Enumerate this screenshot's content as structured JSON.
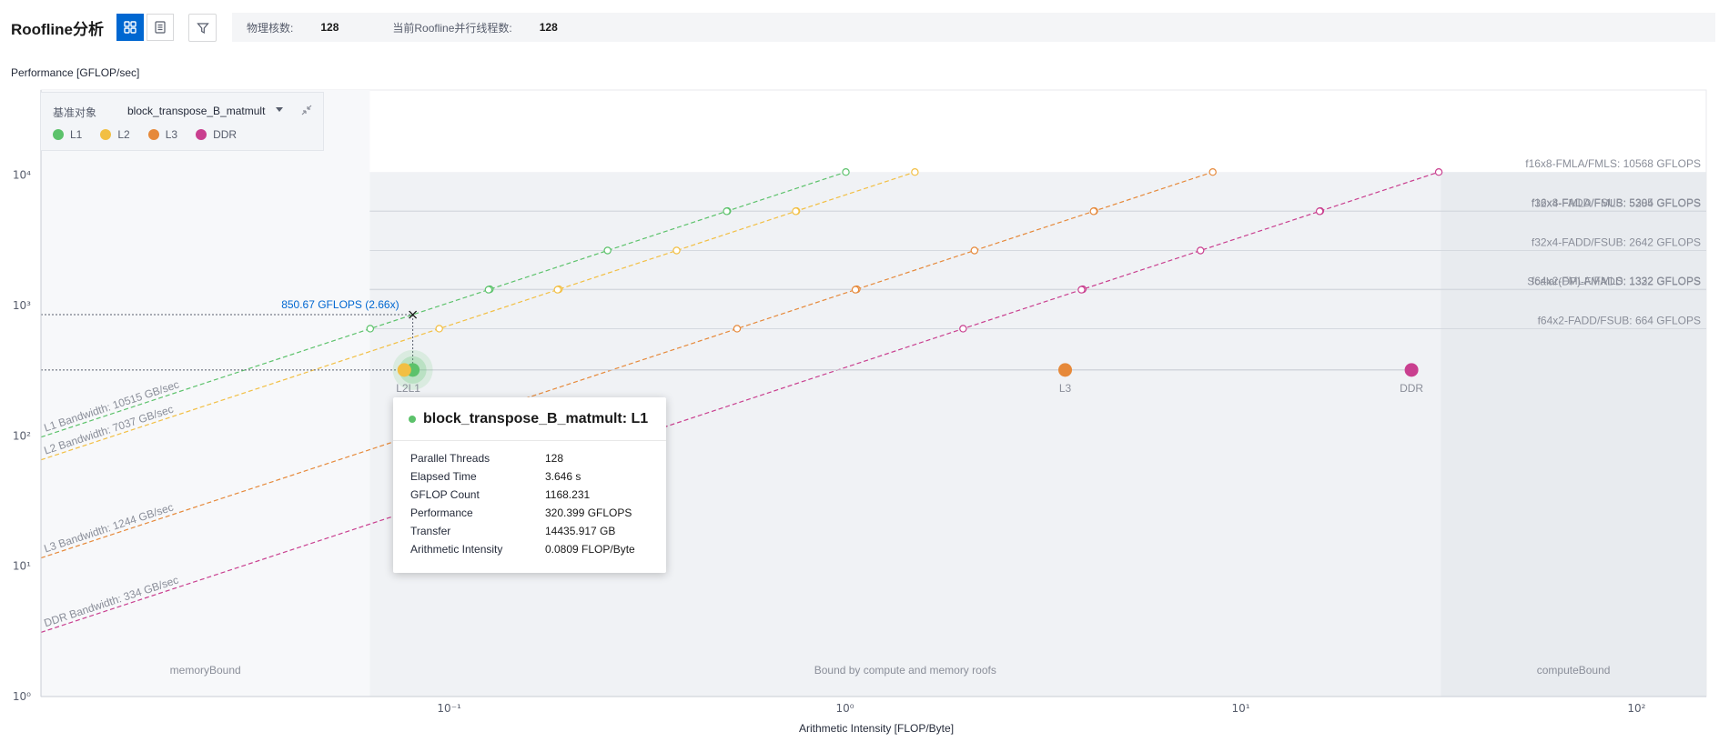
{
  "header": {
    "title": "Roofline分析",
    "physical_cores_label": "物理核数:",
    "physical_cores_value": "128",
    "threads_label": "当前Roofline并行线程数:",
    "threads_value": "128"
  },
  "colors": {
    "accent": "#0067d1",
    "L1": "#5cc26b",
    "L2": "#f2bf43",
    "L3": "#e6893a",
    "DDR": "#c93f8f"
  },
  "legend": {
    "baseline_label": "基准对象",
    "baseline_value": "block_transpose_B_matmult",
    "items": [
      {
        "label": "L1",
        "color": "#5cc26b"
      },
      {
        "label": "L2",
        "color": "#f2bf43"
      },
      {
        "label": "L3",
        "color": "#e6893a"
      },
      {
        "label": "DDR",
        "color": "#c93f8f"
      }
    ]
  },
  "tooltip": {
    "title": "block_transpose_B_matmult: L1",
    "rows": [
      {
        "key": "Parallel Threads",
        "value": "128"
      },
      {
        "key": "Elapsed Time",
        "value": "3.646 s"
      },
      {
        "key": "GFLOP Count",
        "value": "1168.231"
      },
      {
        "key": "Performance",
        "value": "320.399 GFLOPS"
      },
      {
        "key": "Transfer",
        "value": "14435.917 GB"
      },
      {
        "key": "Arithmetic Intensity",
        "value": "0.0809 FLOP/Byte"
      }
    ]
  },
  "chart_data": {
    "type": "scatter",
    "xlabel": "Arithmetic Intensity [FLOP/Byte]",
    "ylabel": "Performance [GFLOP/sec]",
    "xscale": "log",
    "yscale": "log",
    "xlim": [
      0.0093,
      150
    ],
    "ylim": [
      1,
      45000
    ],
    "x_ticks": [
      0.1,
      1,
      10,
      100
    ],
    "x_tick_labels": [
      "10⁻¹",
      "10⁰",
      "10¹",
      "10²"
    ],
    "y_ticks": [
      1,
      10,
      100,
      1000,
      10000
    ],
    "y_tick_labels": [
      "10⁰",
      "10¹",
      "10²",
      "10³",
      "10⁴"
    ],
    "regions": [
      {
        "label": "memoryBound",
        "x_range": [
          0.0093,
          0.063
        ]
      },
      {
        "label": "Bound by compute and memory roofs",
        "x_range": [
          0.063,
          32
        ]
      },
      {
        "label": "computeBound",
        "x_range": [
          32,
          150
        ]
      }
    ],
    "bandwidth_roofs": [
      {
        "name": "L1",
        "label": "L1 Bandwidth: 10515 GB/sec",
        "bandwidth": 10515,
        "color": "#5cc26b"
      },
      {
        "name": "L2",
        "label": "L2 Bandwidth: 7037 GB/sec",
        "bandwidth": 7037,
        "color": "#f2bf43"
      },
      {
        "name": "L3",
        "label": "L3 Bandwidth: 1244 GB/sec",
        "bandwidth": 1244,
        "color": "#e6893a"
      },
      {
        "name": "DDR",
        "label": "DDR Bandwidth: 334 GB/sec",
        "bandwidth": 334,
        "color": "#c93f8f"
      }
    ],
    "compute_roofs": [
      {
        "label": "f16x8-FMLA/FMLS: 10568 GFLOPS",
        "value": 10568
      },
      {
        "label": "f16x8-FADD/FSUB: 5305 GFLOPS",
        "value": 5305
      },
      {
        "label": "f32x4-FMLA/FMLS: 5284 GFLOPS",
        "value": 5284
      },
      {
        "label": "f32x4-FADD/FSUB: 2642 GFLOPS",
        "value": 2642
      },
      {
        "label": "f64x2-FMLA/FMLS: 1332 GFLOPS",
        "value": 1332
      },
      {
        "label": "Scalar(DP)-FMADD: 1322 GFLOPS",
        "value": 1322
      },
      {
        "label": "f64x2-FADD/FSUB: 664 GFLOPS",
        "value": 664
      }
    ],
    "points": [
      {
        "name": "L1",
        "x": 0.0809,
        "y": 320.399,
        "color": "#5cc26b"
      },
      {
        "name": "L2",
        "x": 0.077,
        "y": 320.399,
        "color": "#f2bf43"
      },
      {
        "name": "L3",
        "x": 3.6,
        "y": 320.399,
        "color": "#e6893a"
      },
      {
        "name": "DDR",
        "x": 27,
        "y": 320.399,
        "color": "#c93f8f"
      }
    ],
    "point_label_L1_L2": "L2L1",
    "attainable": {
      "x": 0.0809,
      "y": 850.67,
      "label": "850.67 GFLOPS (2.66x)"
    }
  }
}
